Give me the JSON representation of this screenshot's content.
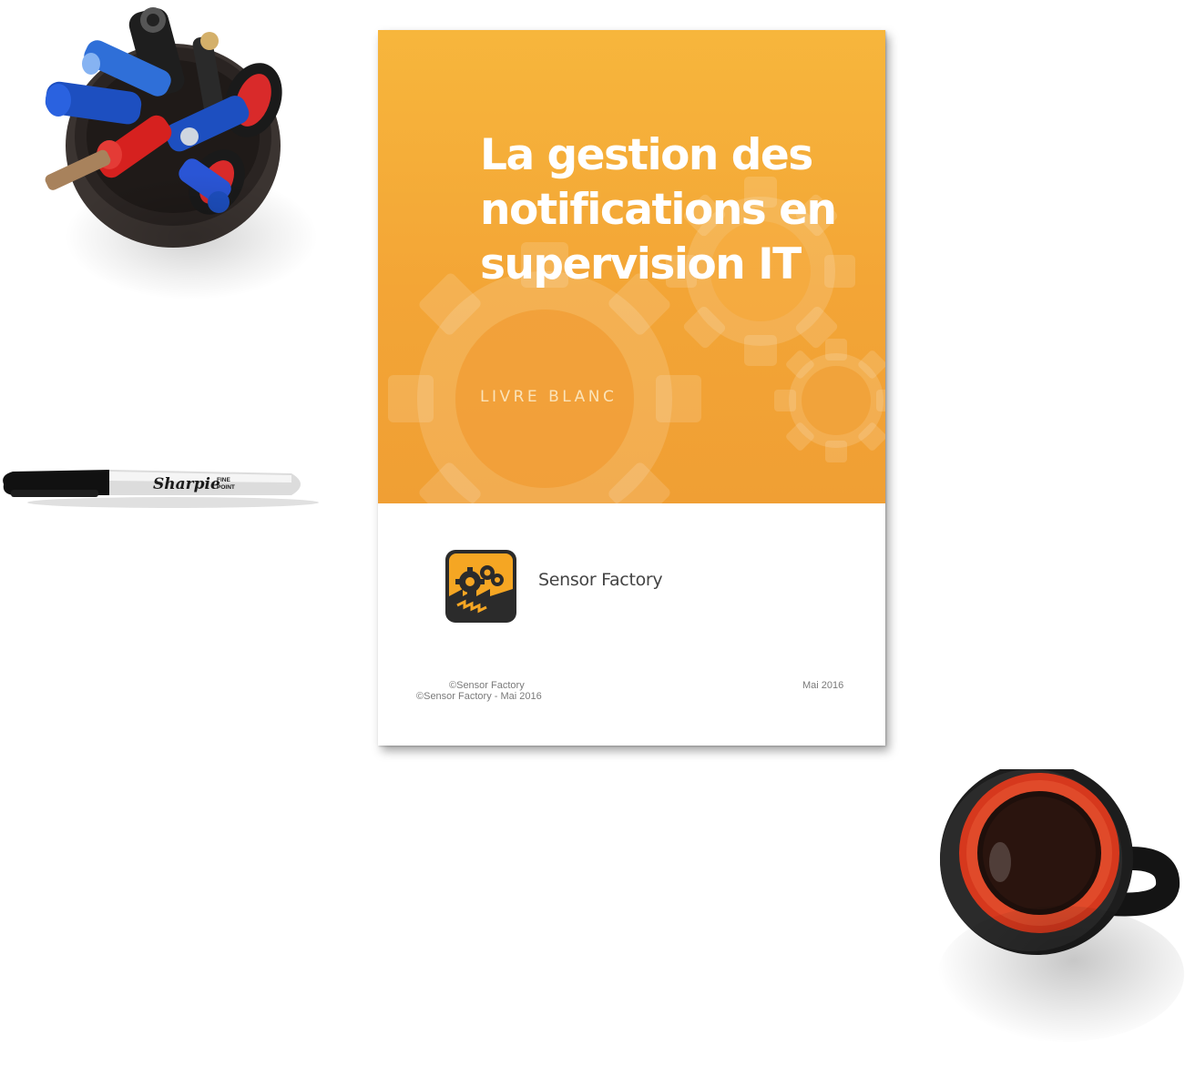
{
  "booklet": {
    "title_lines": [
      "La gestion des",
      "notifications en",
      "supervision IT"
    ],
    "subtitle": "LIVRE BLANC",
    "brand_name": "Sensor Factory",
    "footer": {
      "copyright_line_1": "©Sensor Factory",
      "copyright_line_2": "©Sensor Factory - Mai 2016",
      "date": "Mai 2016"
    }
  },
  "props": {
    "marker_brand": "Sharpie",
    "marker_tip": [
      "FINE",
      "POINT"
    ]
  },
  "colors": {
    "cover_orange": "#f3a536",
    "title_text": "#ffffff",
    "logo_orange": "#f5a623",
    "mug_red": "#d93a1f"
  }
}
